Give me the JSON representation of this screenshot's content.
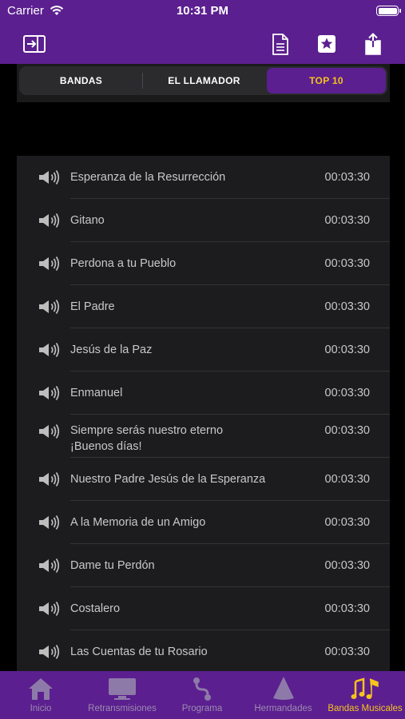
{
  "status": {
    "carrier": "Carrier",
    "time": "10:31 PM"
  },
  "nav": {
    "left_icon": "sidebar-toggle-icon",
    "right_icons": [
      "document-icon",
      "favorite-star-icon",
      "share-icon"
    ]
  },
  "segments": [
    {
      "label": "BANDAS",
      "active": false
    },
    {
      "label": "EL LLAMADOR",
      "active": false
    },
    {
      "label": "TOP 10",
      "active": true
    }
  ],
  "tracks": [
    {
      "title": "Esperanza de la Resurrección",
      "duration": "00:03:30"
    },
    {
      "title": "Gitano",
      "duration": "00:03:30"
    },
    {
      "title": "Perdona a tu Pueblo",
      "duration": "00:03:30"
    },
    {
      "title": "El Padre",
      "duration": "00:03:30"
    },
    {
      "title": "Jesús de la Paz",
      "duration": "00:03:30"
    },
    {
      "title": "Enmanuel",
      "duration": "00:03:30"
    },
    {
      "title": "Siempre serás nuestro eterno ¡Buenos días!",
      "duration": "00:03:30"
    },
    {
      "title": "Nuestro Padre Jesús de la Esperanza",
      "duration": "00:03:30"
    },
    {
      "title": "A la Memoria de un Amigo",
      "duration": "00:03:30"
    },
    {
      "title": "Dame tu Perdón",
      "duration": "00:03:30"
    },
    {
      "title": "Costalero",
      "duration": "00:03:30"
    },
    {
      "title": "Las Cuentas de tu Rosario",
      "duration": "00:03:30"
    }
  ],
  "tabs": [
    {
      "label": "Inicio",
      "icon": "home-icon",
      "active": false
    },
    {
      "label": "Retransmisiones",
      "icon": "tv-icon",
      "active": false
    },
    {
      "label": "Programa",
      "icon": "route-icon",
      "active": false
    },
    {
      "label": "Hermandades",
      "icon": "nazareno-hood-icon",
      "active": false
    },
    {
      "label": "Bandas Musicales",
      "icon": "music-notes-icon",
      "active": true
    }
  ],
  "colors": {
    "brand": "#5b1f8f",
    "accent": "#f5c41d",
    "list_bg": "#1c1c1e",
    "inactive_tab": "#9c8bb0"
  }
}
